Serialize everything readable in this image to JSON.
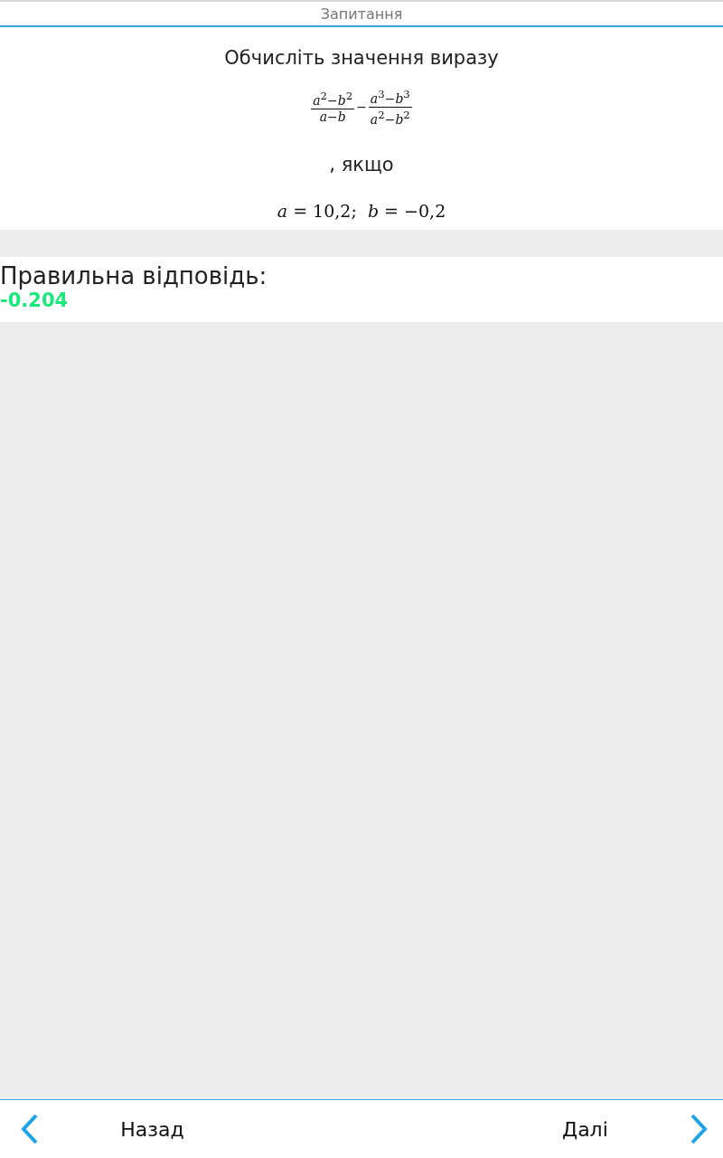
{
  "header": {
    "title": "Запитання"
  },
  "question": {
    "prompt": "Обчисліть значення виразу",
    "formula": [
      {
        "kind": "fraction",
        "numerator": "*a*$^{2}$−*b*$^{2}$",
        "denominator": "*a*−*b*"
      },
      {
        "kind": "operator",
        "text": "−"
      },
      {
        "kind": "fraction",
        "numerator": "*a*$^{3}$−*b*$^{3}$",
        "denominator": "*a*$^{2}$−*b*$^{2}$"
      }
    ],
    "condition_word": ", якщо",
    "condition": "*a* = 10,2;  *b* = −0,2"
  },
  "answer": {
    "label": "Правильна відповідь:",
    "value": "-0.204"
  },
  "footer": {
    "back": "Назад",
    "next": "Далі"
  }
}
